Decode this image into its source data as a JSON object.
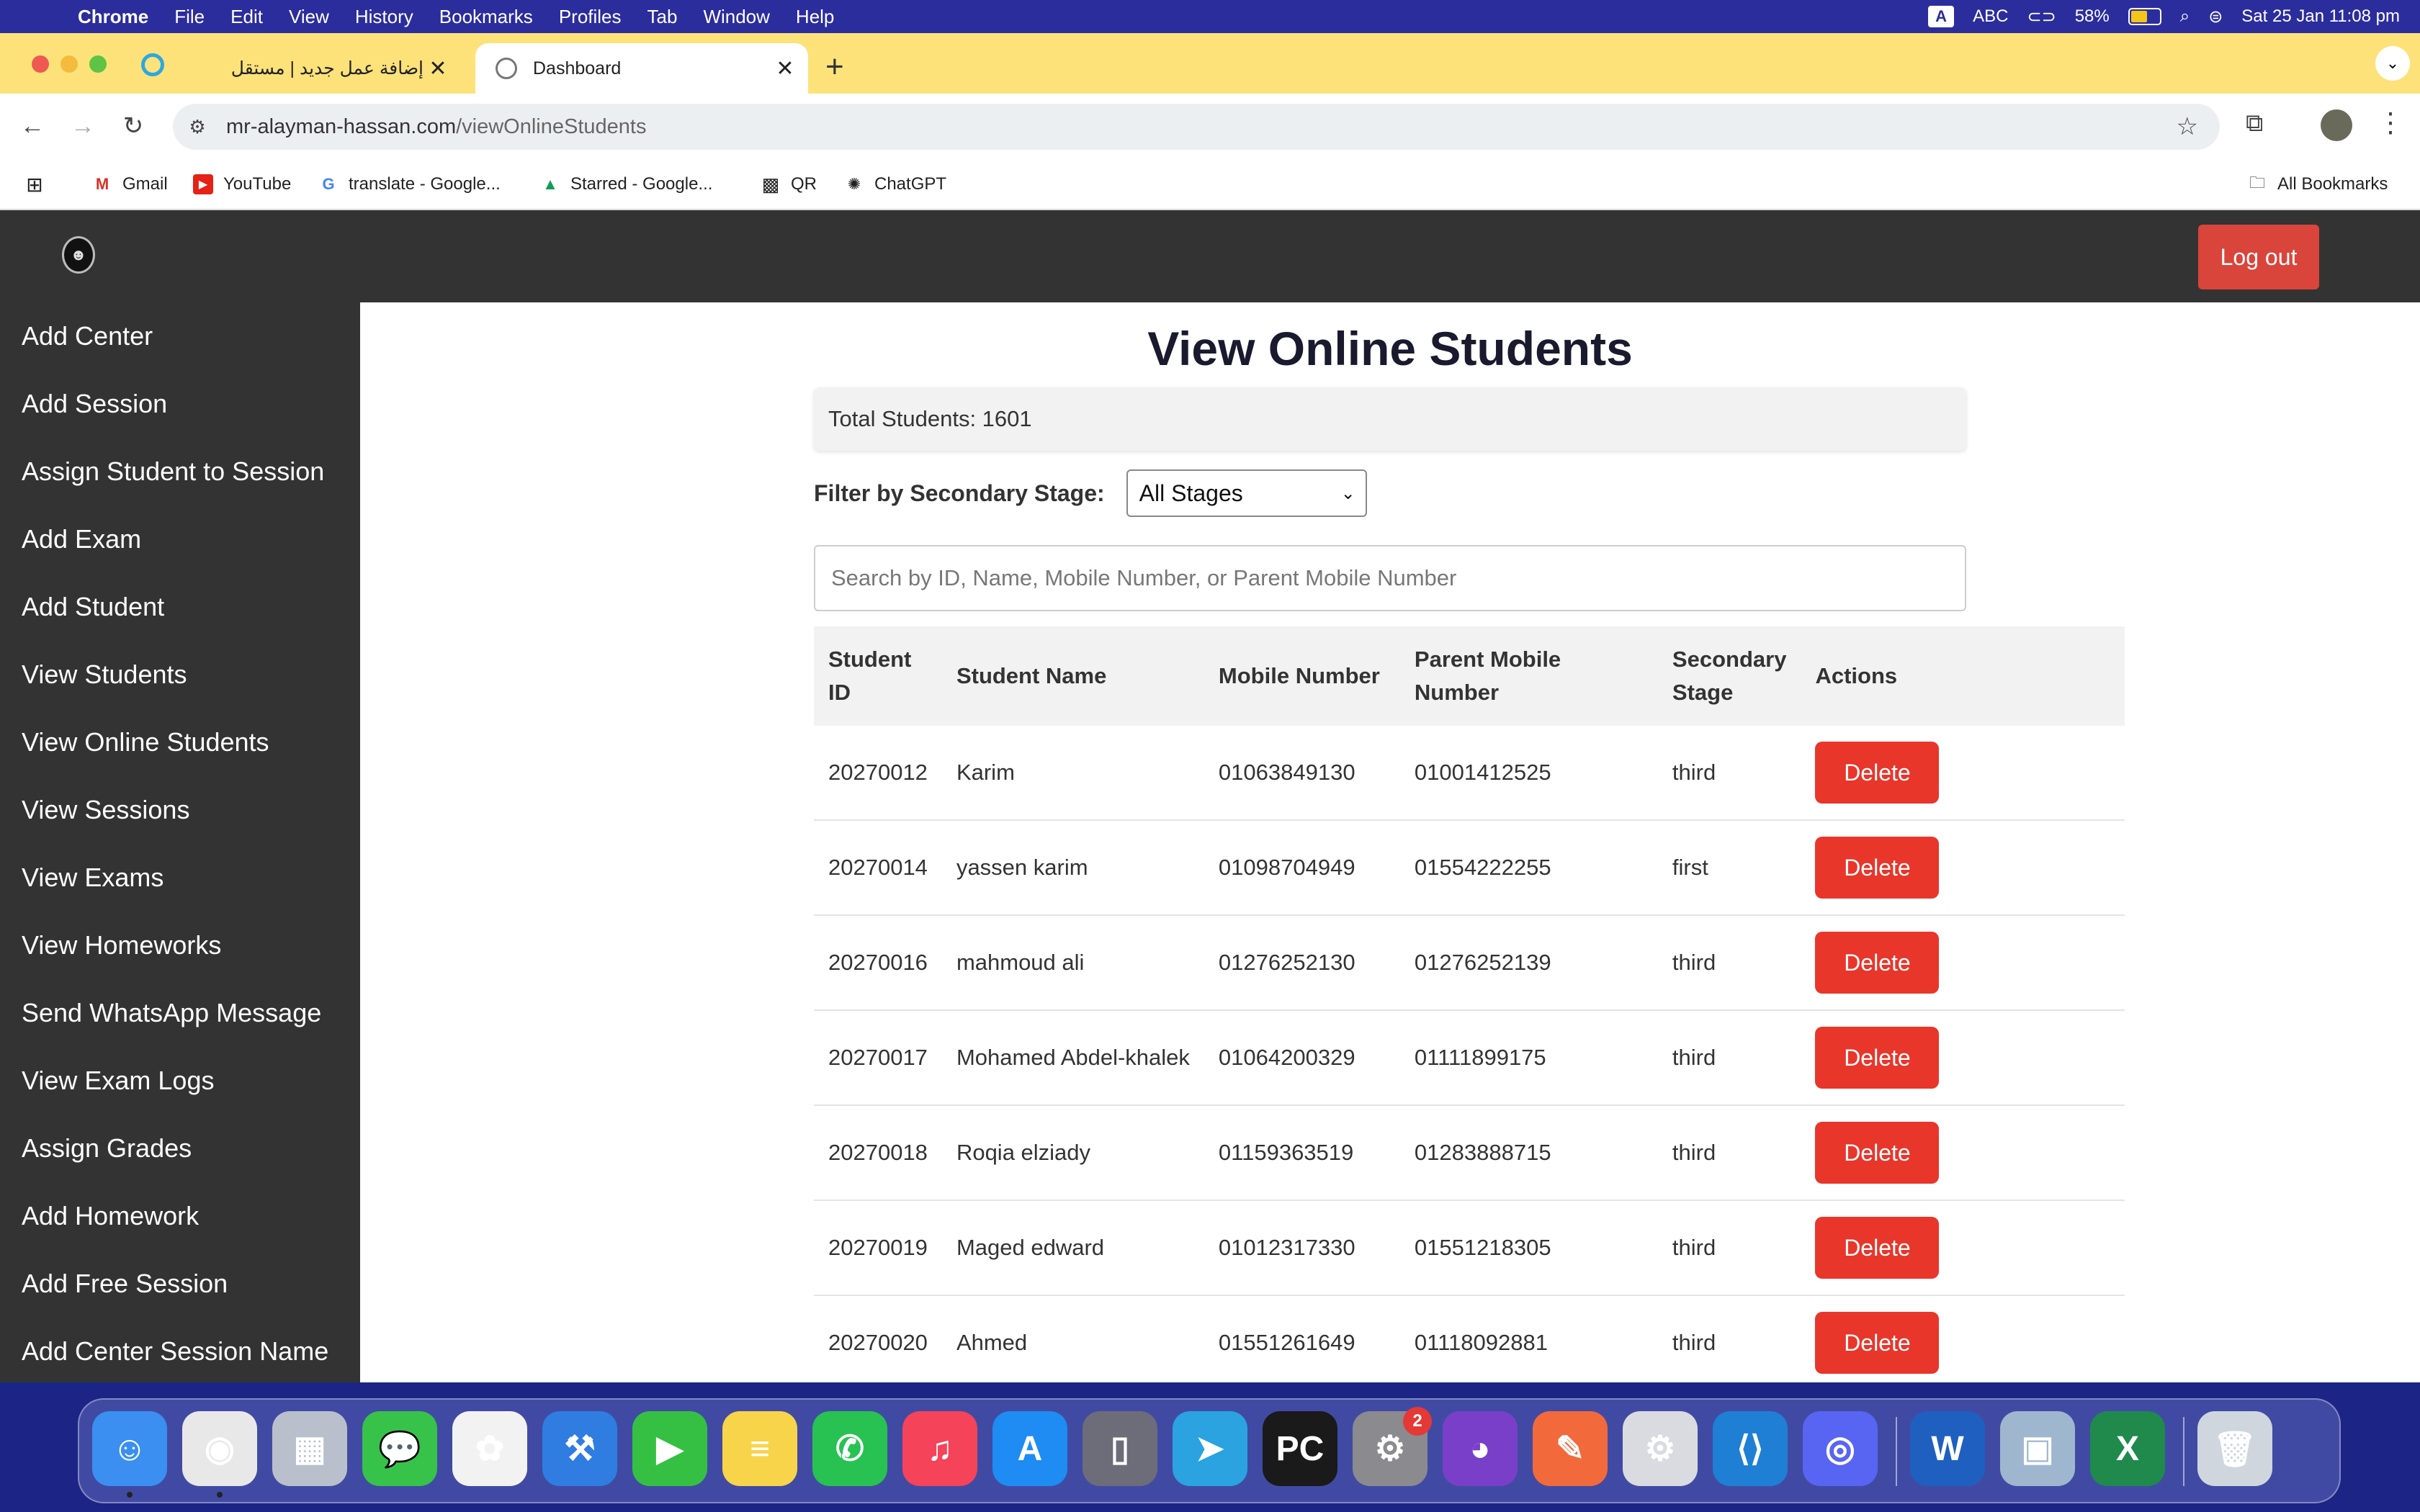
{
  "menubar": {
    "app": "Chrome",
    "items": [
      "File",
      "Edit",
      "View",
      "History",
      "Bookmarks",
      "Profiles",
      "Tab",
      "Window",
      "Help"
    ],
    "input_badge": "A",
    "input_source": "ABC",
    "battery_percent": "58%",
    "battery_level": 0.58,
    "datetime": "Sat 25 Jan  11:08 pm"
  },
  "tabs": [
    {
      "title": "إضافة عمل جديد | مستقل",
      "active": false,
      "favicon_color": "#2ea7e0"
    },
    {
      "title": "Dashboard",
      "active": true,
      "favicon_color": "#777777"
    }
  ],
  "toolbar": {
    "url_domain": "mr-alayman-hassan.com",
    "url_path": "/viewOnlineStudents"
  },
  "bookmarks": [
    {
      "label": "Gmail",
      "icon": "gmail-icon"
    },
    {
      "label": "YouTube",
      "icon": "youtube-icon"
    },
    {
      "label": "translate - Google...",
      "icon": "google-icon"
    },
    {
      "label": "Starred - Google...",
      "icon": "google-drive-icon"
    },
    {
      "label": "QR",
      "icon": "qr-icon"
    },
    {
      "label": "ChatGPT",
      "icon": "chatgpt-icon"
    }
  ],
  "all_bookmarks": "All Bookmarks",
  "app": {
    "logout_label": "Log out",
    "sidebar": [
      "Add Center",
      "Add Session",
      "Assign Student to Session",
      "Add Exam",
      "Add Student",
      "View Students",
      "View Online Students",
      "View Sessions",
      "View Exams",
      "View Homeworks",
      "Send WhatsApp Message",
      "View Exam Logs",
      "Assign Grades",
      "Add Homework",
      "Add Free Session",
      "Add Center Session Name"
    ],
    "page_title": "View Online Students",
    "total_students": "Total Students: 1601",
    "filter_label": "Filter by Secondary Stage:",
    "filter_value": "All Stages",
    "search_placeholder": "Search by ID, Name, Mobile Number, or Parent Mobile Number",
    "table": {
      "headers": [
        "Student ID",
        "Student Name",
        "Mobile Number",
        "Parent Mobile Number",
        "Secondary Stage",
        "Actions"
      ],
      "delete_label": "Delete",
      "rows": [
        {
          "id": "20270012",
          "name": "Karim",
          "mobile": "01063849130",
          "parent": "01001412525",
          "stage": "third"
        },
        {
          "id": "20270014",
          "name": "yassen karim",
          "mobile": "01098704949",
          "parent": "01554222255",
          "stage": "first"
        },
        {
          "id": "20270016",
          "name": "mahmoud ali",
          "mobile": "01276252130",
          "parent": "01276252139",
          "stage": "third"
        },
        {
          "id": "20270017",
          "name": "Mohamed Abdel-khalek",
          "mobile": "01064200329",
          "parent": "01111899175",
          "stage": "third"
        },
        {
          "id": "20270018",
          "name": "Roqia elziady",
          "mobile": "01159363519",
          "parent": "01283888715",
          "stage": "third"
        },
        {
          "id": "20270019",
          "name": "Maged edward",
          "mobile": "01012317330",
          "parent": "01551218305",
          "stage": "third"
        },
        {
          "id": "20270020",
          "name": "Ahmed",
          "mobile": "01551261649",
          "parent": "01118092881",
          "stage": "third"
        }
      ]
    }
  },
  "dock": {
    "apps": [
      {
        "name": "finder-icon",
        "color": "#3b8ff0",
        "glyph": "☺"
      },
      {
        "name": "chrome-icon",
        "color": "#e8e8e8",
        "glyph": "◉"
      },
      {
        "name": "launchpad-icon",
        "color": "#b9c0cc",
        "glyph": "▦"
      },
      {
        "name": "messages-icon",
        "color": "#37c24a",
        "glyph": "💬"
      },
      {
        "name": "photos-icon",
        "color": "#f2f2f2",
        "glyph": "✿"
      },
      {
        "name": "xcode-icon",
        "color": "#2f7de1",
        "glyph": "⚒"
      },
      {
        "name": "facetime-icon",
        "color": "#36c043",
        "glyph": "▶"
      },
      {
        "name": "notes-icon",
        "color": "#f7d44a",
        "glyph": "≡"
      },
      {
        "name": "whatsapp-icon",
        "color": "#28c252",
        "glyph": "✆"
      },
      {
        "name": "music-icon",
        "color": "#f5435a",
        "glyph": "♫"
      },
      {
        "name": "app-store-icon",
        "color": "#1e8cf2",
        "glyph": "A"
      },
      {
        "name": "simulator-icon",
        "color": "#6d6d7a",
        "glyph": "▯"
      },
      {
        "name": "telegram-icon",
        "color": "#2aa3e0",
        "glyph": "➤"
      },
      {
        "name": "pycharm-icon",
        "color": "#1a1a1a",
        "glyph": "PC"
      },
      {
        "name": "system-settings-icon",
        "color": "#8a8a8f",
        "glyph": "⚙",
        "badge": "2"
      },
      {
        "name": "github-desktop-icon",
        "color": "#7a3fc8",
        "glyph": "◕"
      },
      {
        "name": "pencil-icon",
        "color": "#f26a3c",
        "glyph": "✎"
      },
      {
        "name": "utility-settings-icon",
        "color": "#d9dbe0",
        "glyph": "⚙"
      },
      {
        "name": "vscode-icon",
        "color": "#1f7fd4",
        "glyph": "⟨⟩"
      },
      {
        "name": "discord-icon",
        "color": "#5865f2",
        "glyph": "◎"
      },
      {
        "name": "word-icon",
        "color": "#1f5fbf",
        "glyph": "W"
      },
      {
        "name": "preview-icon",
        "color": "#9fb6cf",
        "glyph": "▣"
      },
      {
        "name": "excel-icon",
        "color": "#1f8a4c",
        "glyph": "X"
      },
      {
        "name": "trash-icon",
        "color": "#cfd6de",
        "glyph": "🗑"
      }
    ]
  }
}
